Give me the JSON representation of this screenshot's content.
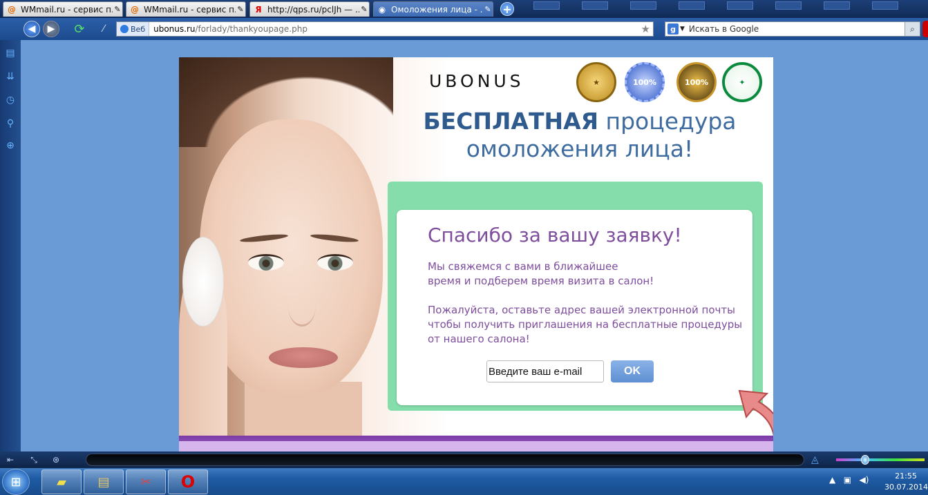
{
  "tabs": [
    {
      "label": "WMmail.ru - сервис п...",
      "icon": "at-icon"
    },
    {
      "label": "WMmail.ru - сервис п...",
      "icon": "at-icon"
    },
    {
      "label": "http://qps.ru/pclJh — ...",
      "icon": "yandex-icon"
    },
    {
      "label": "Омоложения лица - ...",
      "icon": "globe-icon"
    }
  ],
  "address_bar": {
    "badge": "Веб",
    "host": "ubonus.ru",
    "path": "/forlady/thankyoupage.php"
  },
  "search": {
    "placeholder": "Искать в Google"
  },
  "page": {
    "brand": "UBONUS",
    "headline_bold": "БЕСПЛАТНАЯ",
    "headline_rest": " процедура",
    "headline_line2": "омоложения лица!",
    "seals": [
      "seal-gold",
      "seal-100-blue",
      "seal-100-gold",
      "seal-green"
    ],
    "thanks_title": "Спасибо за вашу заявку!",
    "message_1_line1": "Мы свяжемся с вами в ближайшее",
    "message_1_line2": "время и подберем время визита в салон!",
    "message_2_line1": "Пожалуйста, оставьте адрес вашей электронной почты",
    "message_2_line2": "чтобы получить приглашения на бесплатные процедуры",
    "message_2_line3": "от нашего салона!",
    "email_value": "Введите ваш e-mail",
    "ok_label": "OK"
  },
  "taskbar": {
    "time": "21:55",
    "date": "30.07.2014"
  },
  "colors": {
    "accent_purple": "#7e4e9d",
    "headline_blue": "#3e6ca0",
    "frame_green": "#84ddaa",
    "ok_button": "#6f9dd9"
  }
}
